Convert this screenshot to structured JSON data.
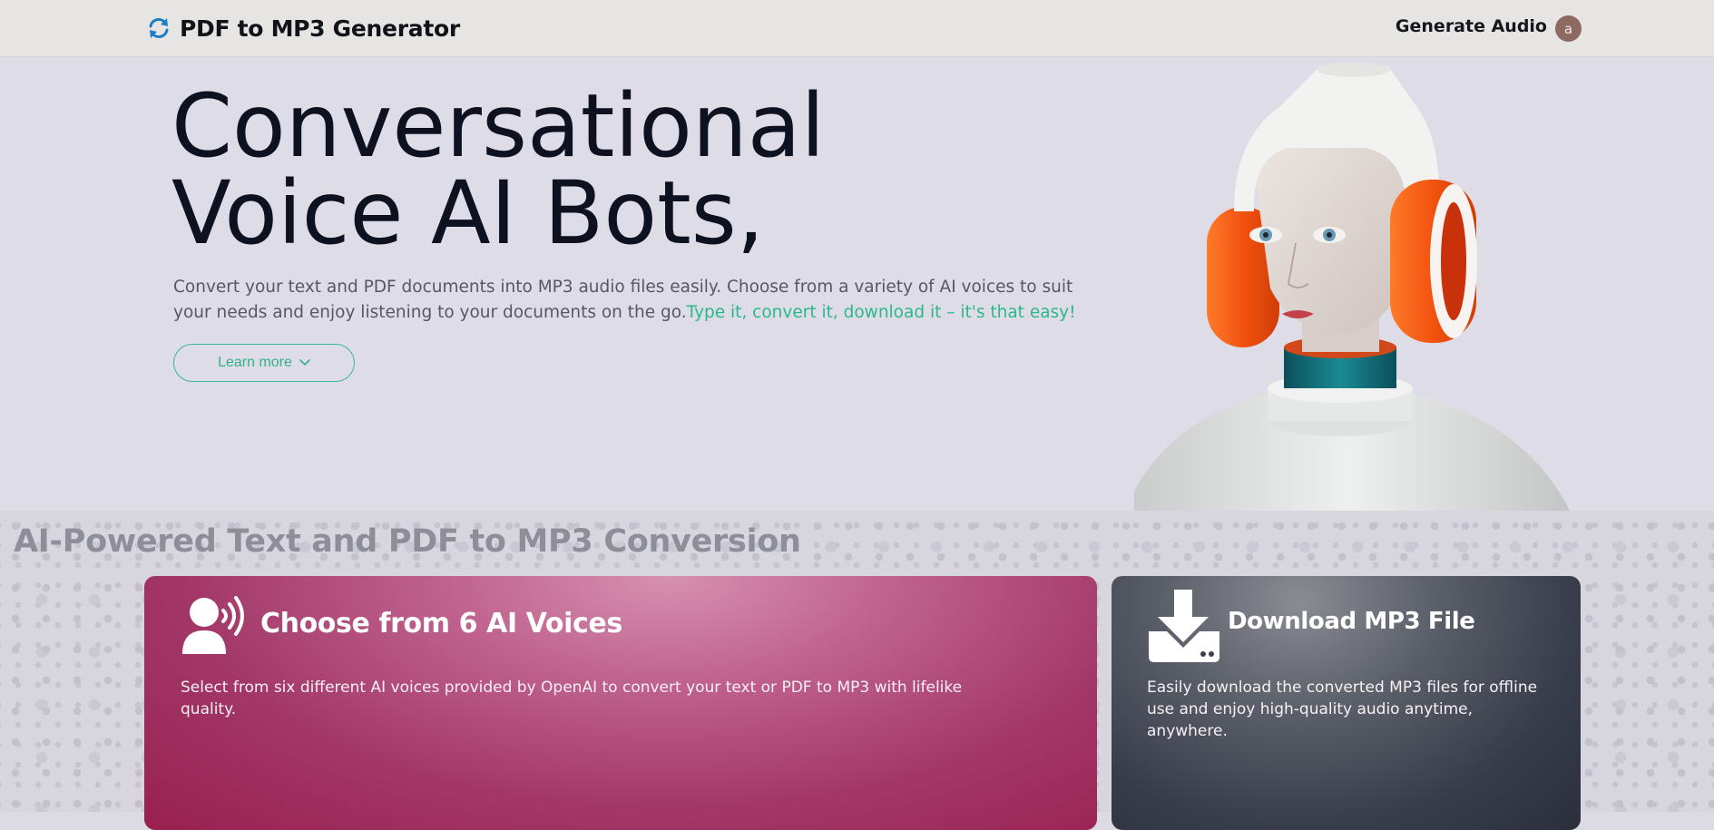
{
  "header": {
    "brand_title": "PDF to MP3 Generator",
    "brand_icon": "sync-arrows-icon",
    "nav_link": "Generate Audio",
    "avatar_initial": "a",
    "accent_color": "#1a7fc4"
  },
  "hero": {
    "title_line1": "Conversational",
    "title_line2": "Voice AI Bots,",
    "description": "Convert your text and PDF documents into MP3 audio files easily. Choose from a variety of AI voices to suit your needs and enjoy listening to your documents on the go.",
    "description_accent": "Type it, convert it, download it – it's that easy!",
    "learn_more_label": "Learn more",
    "accent_color": "#2bb88d"
  },
  "features": {
    "section_title": "AI-Powered Text and PDF to MP3 Conversion",
    "cards": [
      {
        "icon": "speaking-person-icon",
        "title": "Choose from 6 AI Voices",
        "text": "Select from six different AI voices provided by OpenAI to convert your text or PDF to MP3 with lifelike quality.",
        "color": "#a23767"
      },
      {
        "icon": "download-icon",
        "title": "Download MP3 File",
        "text": "Easily download the converted MP3 files for offline use and enjoy high-quality audio anytime, anywhere.",
        "color": "#383d4a"
      }
    ]
  }
}
